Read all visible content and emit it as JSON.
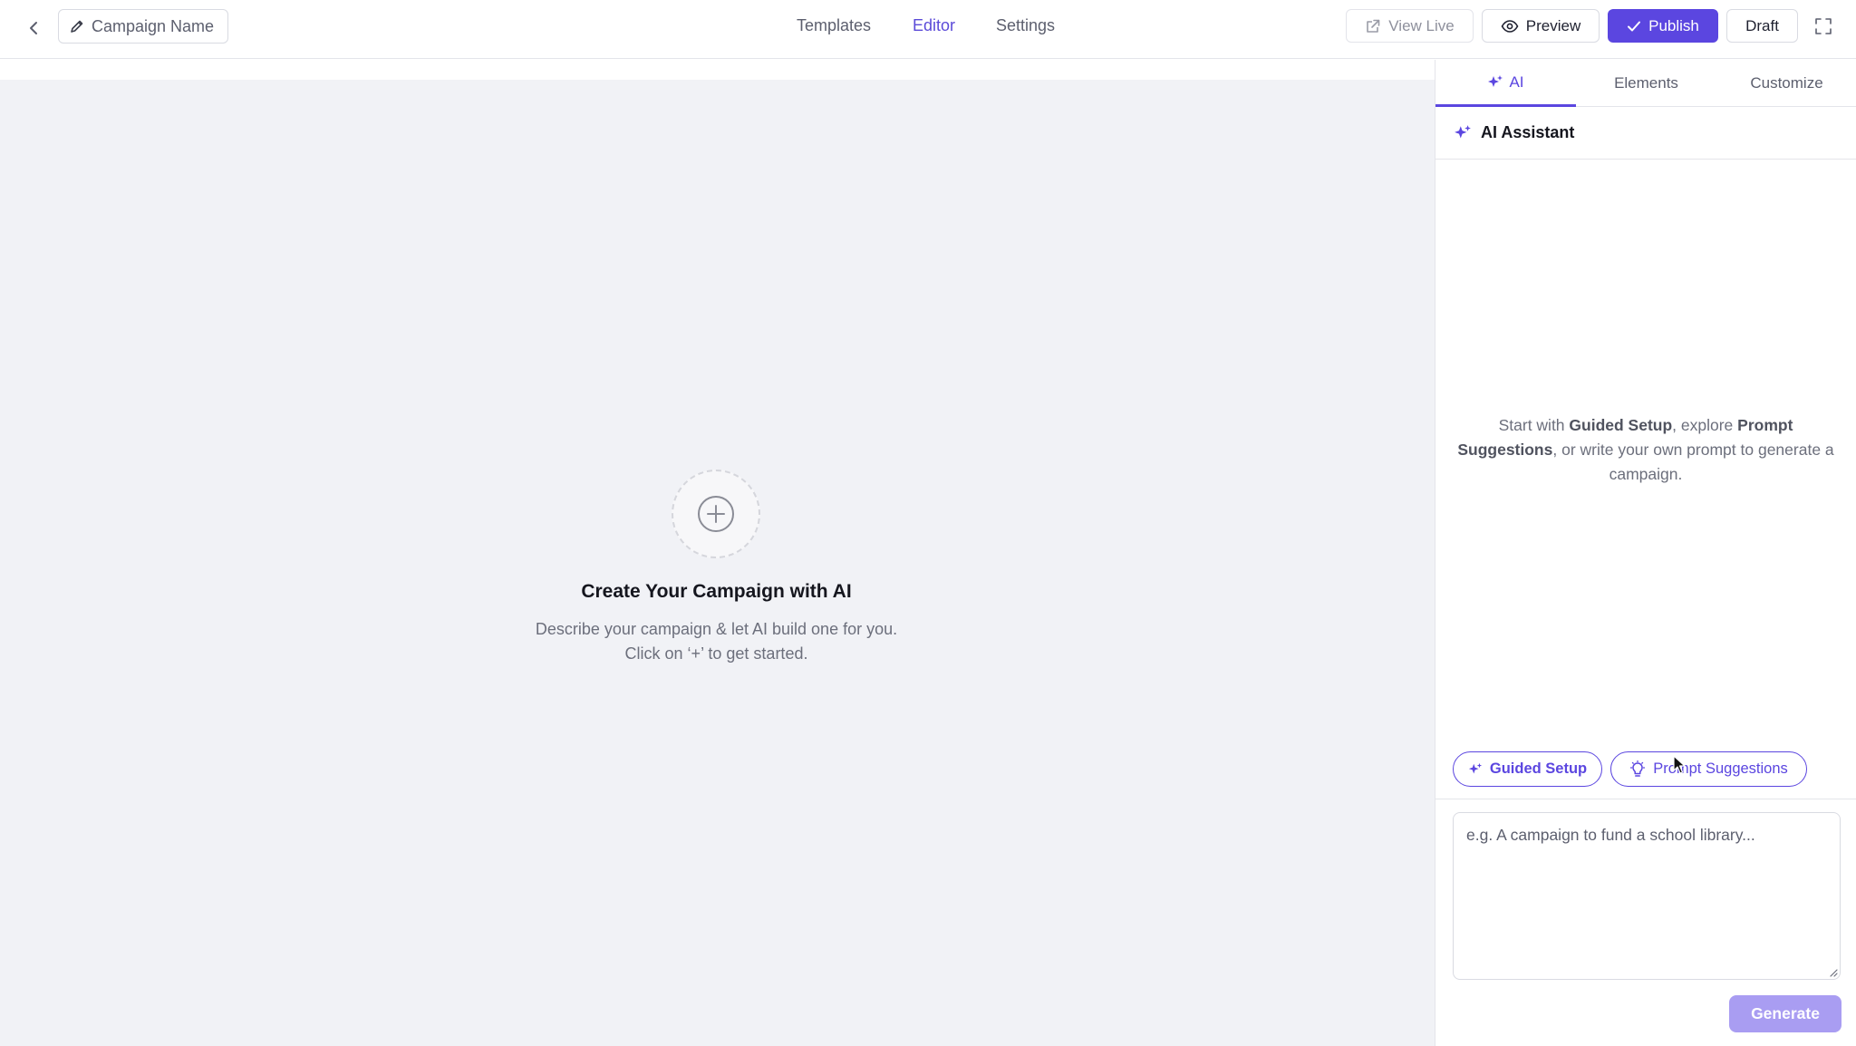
{
  "header": {
    "campaign_name": "Campaign Name",
    "nav_tabs": [
      {
        "label": "Templates",
        "active": false
      },
      {
        "label": "Editor",
        "active": true
      },
      {
        "label": "Settings",
        "active": false
      }
    ],
    "actions": {
      "view_live": "View Live",
      "preview": "Preview",
      "publish": "Publish",
      "draft": "Draft"
    }
  },
  "canvas": {
    "empty_title": "Create Your Campaign with AI",
    "empty_line1": "Describe your campaign & let AI build one for you.",
    "empty_line2": "Click on ‘+’ to get started."
  },
  "panel": {
    "tabs": [
      {
        "label": "AI",
        "active": true
      },
      {
        "label": "Elements",
        "active": false
      },
      {
        "label": "Customize",
        "active": false
      }
    ],
    "assistant_title": "AI Assistant",
    "intro": {
      "part1": "Start with ",
      "bold1": "Guided Setup",
      "part2": ", explore ",
      "bold2": "Prompt Suggestions",
      "part3": ", or write your own prompt to generate a campaign."
    },
    "chips": {
      "guided_setup": "Guided Setup",
      "prompt_suggestions": "Prompt Suggestions"
    },
    "prompt": {
      "value": "",
      "placeholder": "e.g. A campaign to fund a school library..."
    },
    "generate": "Generate"
  },
  "colors": {
    "accent": "#5b46e0",
    "accent_disabled": "#a99df2",
    "canvas_bg": "#f1f2f6"
  },
  "icons": {
    "back": "chevron-left-icon",
    "edit": "pencil-icon",
    "view_live": "external-link-icon",
    "preview": "eye-icon",
    "publish": "check-icon",
    "fullscreen": "expand-icon",
    "add": "plus-circle-icon",
    "ai": "sparkle-icon",
    "prompt_suggestions": "lightbulb-icon"
  }
}
